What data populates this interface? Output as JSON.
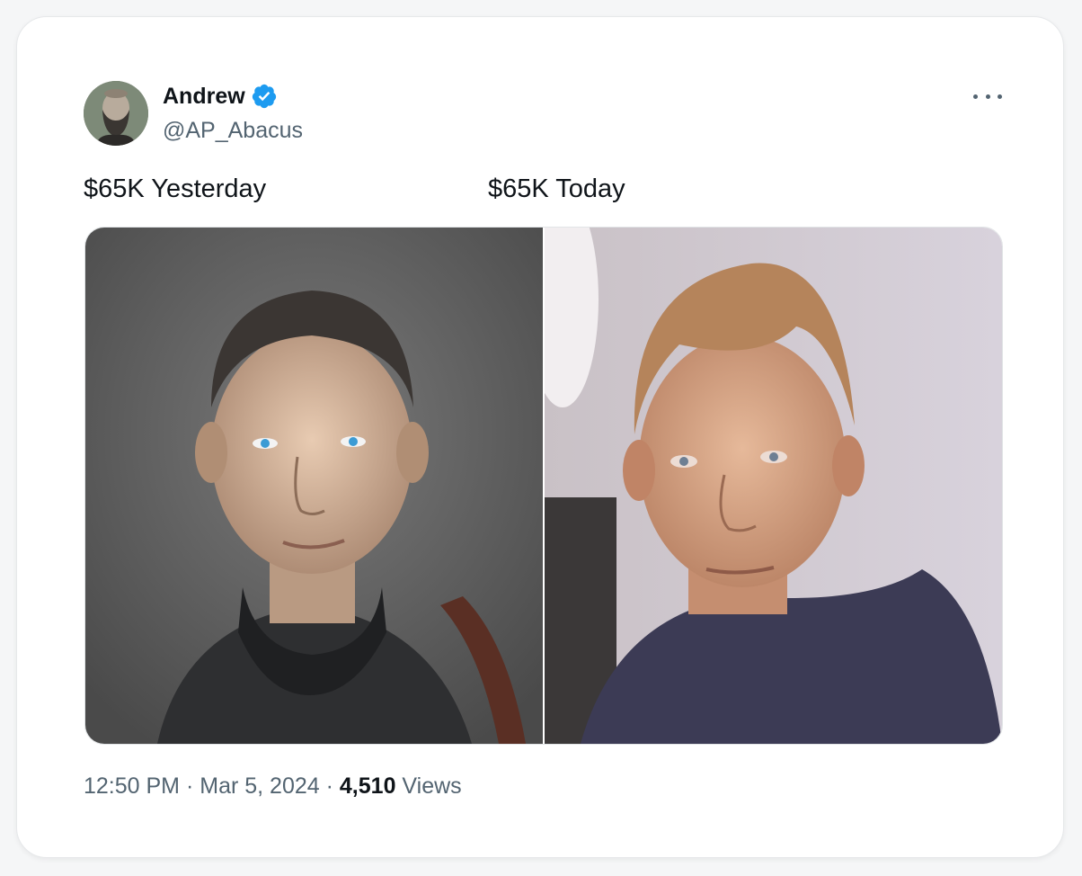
{
  "author": {
    "name": "Andrew",
    "handle": "@AP_Abacus",
    "verified_color": "#1d9bf0"
  },
  "post": {
    "caption_left": "$65K Yesterday",
    "caption_right": "$65K Today",
    "time": "12:50 PM",
    "separator": "·",
    "date": "Mar 5, 2024",
    "views_count": "4,510",
    "views_label": "Views"
  },
  "icons": {
    "verified": "verified-badge-icon",
    "more": "more-options-icon"
  },
  "colors": {
    "primary_text": "#0f1419",
    "secondary_text": "#536471",
    "accent": "#1d9bf0"
  }
}
